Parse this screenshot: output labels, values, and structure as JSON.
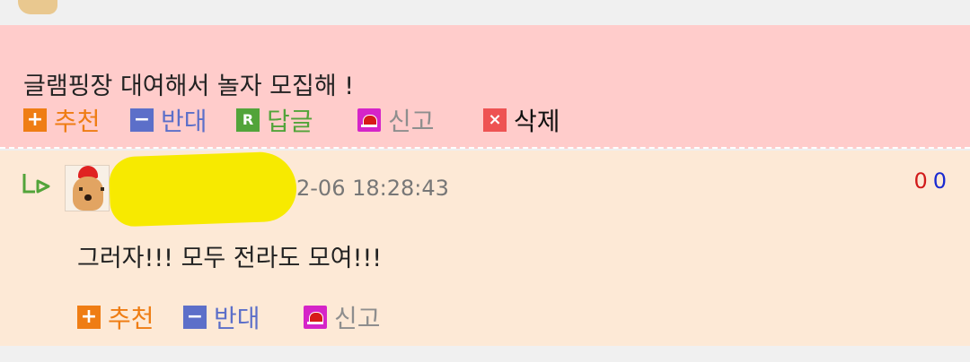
{
  "own_comment": {
    "text": "글램핑장 대여해서 놀자 모집해 !",
    "actions": {
      "recommend": "추천",
      "oppose": "반대",
      "reply": "답글",
      "report": "신고",
      "delete": "삭제"
    },
    "reply_icon_letter": "R",
    "delete_icon_glyph": "×"
  },
  "reply_comment": {
    "timestamp": "2-06 18:28:43",
    "votes_up": "0",
    "votes_down": "0",
    "text": "그러자!!! 모두 전라도 모여!!!",
    "actions": {
      "recommend": "추천",
      "oppose": "반대",
      "report": "신고"
    }
  },
  "icons": {
    "plus": "+",
    "minus": "−"
  },
  "colors": {
    "own_comment_bg": "#ffcccb",
    "reply_comment_bg": "#fde9d6",
    "recommend": "#ef7d14",
    "oppose": "#5c6fc9",
    "reply": "#52a43a",
    "report": "#8e8e8e",
    "delete_icon": "#ee5353",
    "votes_up": "#d11a1a",
    "votes_down": "#1a2ad1",
    "redaction": "#f7ea00"
  }
}
